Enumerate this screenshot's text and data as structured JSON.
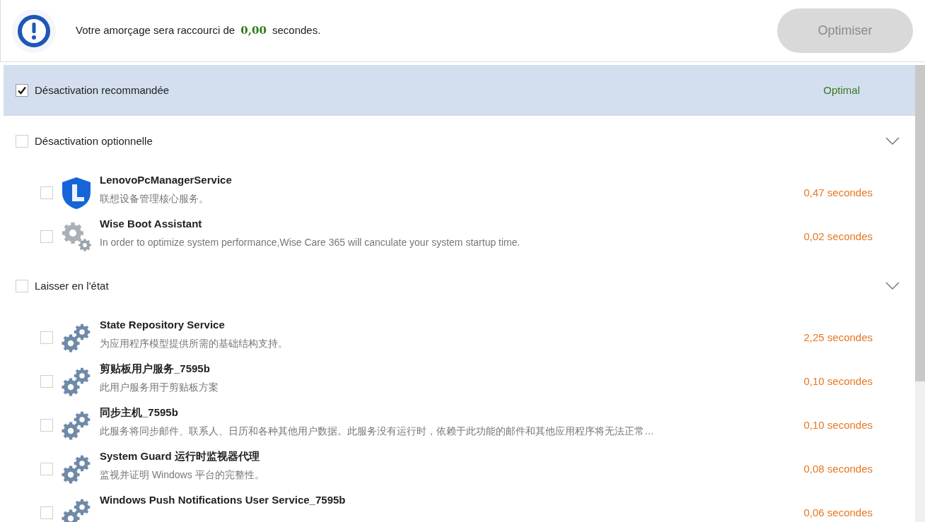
{
  "header": {
    "message": "Votre amorçage sera raccourci de **0,00** secondes.",
    "button": {
      "label": "Optimiser",
      "disabled": true
    }
  },
  "groups": [
    {
      "label": "Désactivation recommandée",
      "checked": true,
      "selected": true,
      "status": "Optimal"
    },
    {
      "label": "Désactivation optionnelle",
      "checked": false,
      "selected": false,
      "expanded": true,
      "items": [
        {
          "kind": "shield",
          "name": "LenovoPcManagerService",
          "description": "联想设备管理核心服务。",
          "time": "0,47 secondes",
          "checked": false
        },
        {
          "kind": "gears",
          "name": "Wise Boot Assistant",
          "description": "In order to optimize system performance,Wise Care 365 will canculate your system startup time.",
          "time": "0,02 secondes",
          "checked": false
        }
      ]
    },
    {
      "label": "Laisser en l'état",
      "checked": false,
      "selected": false,
      "expanded": true,
      "items": [
        {
          "kind": "gear",
          "name": "State Repository Service",
          "description": "为应用程序模型提供所需的基础结构支持。",
          "time": "2,25 secondes",
          "checked": false
        },
        {
          "kind": "gear",
          "name": "剪贴板用户服务_7595b",
          "description": "此用户服务用于剪贴板方案",
          "time": "0,10 secondes",
          "checked": false
        },
        {
          "kind": "gear",
          "name": "同步主机_7595b",
          "description": "此服务将同步邮件、联系人、日历和各种其他用户数据。此服务没有运行时，依赖于此功能的邮件和其他应用程序将无法正常…",
          "time": "0,10 secondes",
          "checked": false
        },
        {
          "kind": "gear",
          "name": "System Guard 运行时监视器代理",
          "description": "监视并证明 Windows 平台的完整性。",
          "time": "0,08 secondes",
          "checked": false
        },
        {
          "kind": "gear",
          "name": "Windows Push Notifications User Service_7595b",
          "time": "0,06 secondes",
          "checked": false
        }
      ]
    }
  ]
}
